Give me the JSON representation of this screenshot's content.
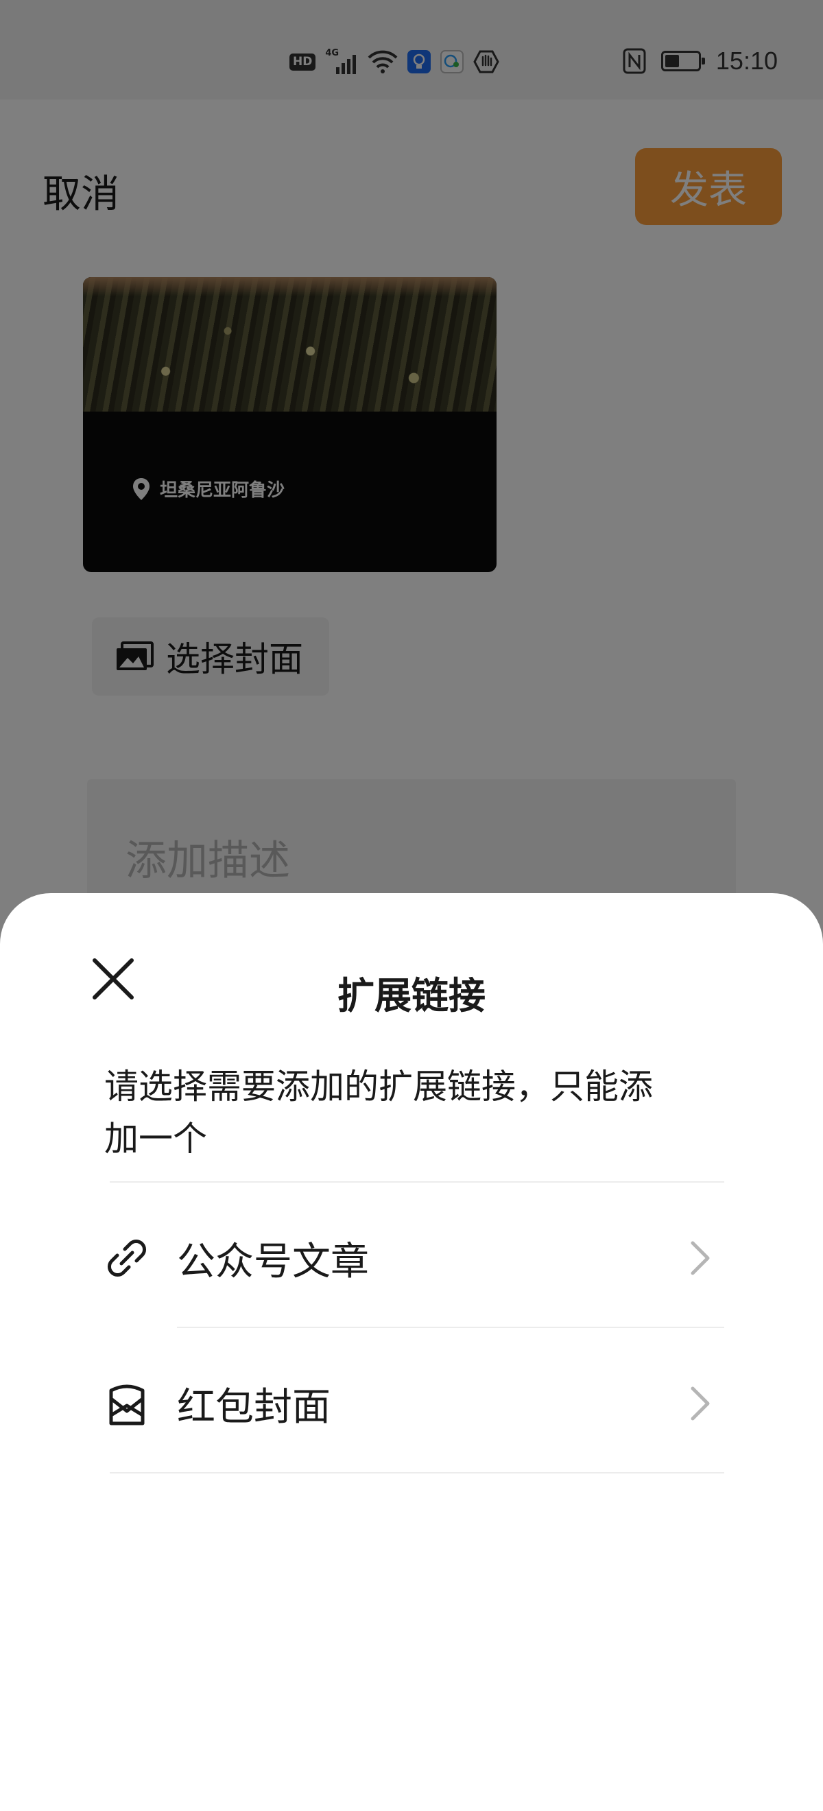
{
  "status_bar": {
    "hd_label": "HD",
    "network_label": "4G",
    "time": "15:10",
    "icons": [
      "hd-icon",
      "signal-icon",
      "wifi-icon",
      "bulb-app-icon",
      "chat-app-icon",
      "hand-app-icon",
      "nfc-icon",
      "battery-icon"
    ]
  },
  "composer": {
    "cancel_label": "取消",
    "publish_label": "发表",
    "location_text": "坦桑尼亚阿鲁沙",
    "choose_cover_label": "选择封面",
    "description_placeholder": "添加描述",
    "accent_color": "#fa9d3b"
  },
  "sheet": {
    "title": "扩展链接",
    "description": "请选择需要添加的扩展链接，只能添加一个",
    "items": [
      {
        "label": "公众号文章",
        "icon": "link-icon"
      },
      {
        "label": "红包封面",
        "icon": "red-packet-icon"
      }
    ]
  }
}
